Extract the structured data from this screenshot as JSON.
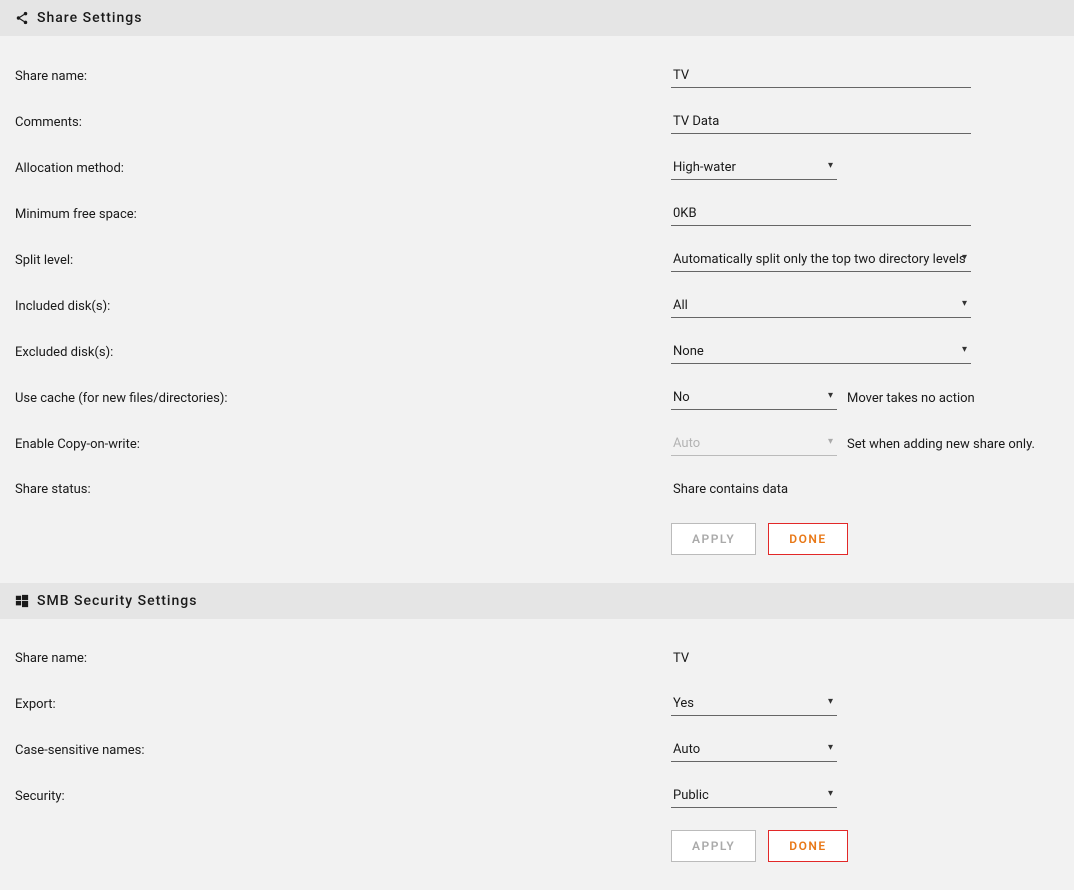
{
  "sections": {
    "share": {
      "title": "Share Settings",
      "rows": {
        "name": {
          "label": "Share name:",
          "value": "TV"
        },
        "comments": {
          "label": "Comments:",
          "value": "TV Data"
        },
        "alloc": {
          "label": "Allocation method:",
          "value": "High-water"
        },
        "minfree": {
          "label": "Minimum free space:",
          "value": "0KB"
        },
        "split": {
          "label": "Split level:",
          "value": "Automatically split only the top two directory levels as required."
        },
        "included": {
          "label": "Included disk(s):",
          "value": "All"
        },
        "excluded": {
          "label": "Excluded disk(s):",
          "value": "None"
        },
        "cache": {
          "label": "Use cache (for new files/directories):",
          "value": "No",
          "help": "Mover takes no action"
        },
        "cow": {
          "label": "Enable Copy-on-write:",
          "value": "Auto",
          "help": "Set when adding new share only."
        },
        "status": {
          "label": "Share status:",
          "value": "Share contains data"
        }
      },
      "buttons": {
        "apply": "Apply",
        "done": "Done"
      }
    },
    "smb": {
      "title": "SMB Security Settings",
      "rows": {
        "name": {
          "label": "Share name:",
          "value": "TV"
        },
        "export": {
          "label": "Export:",
          "value": "Yes"
        },
        "casesens": {
          "label": "Case-sensitive names:",
          "value": "Auto"
        },
        "security": {
          "label": "Security:",
          "value": "Public"
        }
      },
      "buttons": {
        "apply": "Apply",
        "done": "Done"
      }
    }
  }
}
